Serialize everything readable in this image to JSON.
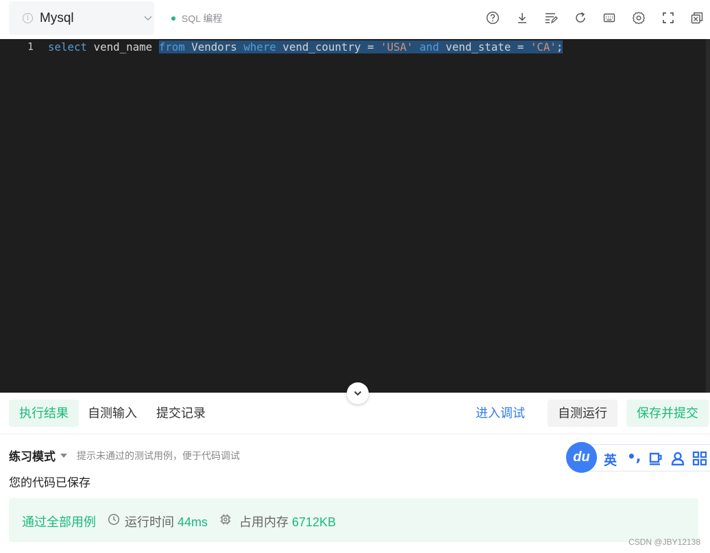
{
  "toolbar": {
    "language": "Mysql",
    "mode": "SQL 编程",
    "icons": [
      "help-icon",
      "download-icon",
      "format-icon",
      "refresh-icon",
      "keyboard-icon",
      "settings-icon",
      "fullscreen-icon",
      "exit-icon"
    ]
  },
  "editor": {
    "line_number": "1",
    "tokens": {
      "t1": "select",
      "t2": " vend_name ",
      "t3": "from",
      "t4": " Vendors ",
      "t5": "where",
      "t6": " vend_country = ",
      "t7": "'USA'",
      "t8": " ",
      "t9": "and",
      "t10": " vend_state = ",
      "t11": "'CA'",
      "t12": ";"
    }
  },
  "result_tabs": {
    "exec_result": "执行结果",
    "self_input": "自测输入",
    "submit_history": "提交记录"
  },
  "actions": {
    "debug": "进入调试",
    "self_run": "自测运行",
    "save_submit": "保存并提交"
  },
  "practice": {
    "title": "练习模式",
    "hint": "提示未通过的测试用例，便于代码调试",
    "saved": "您的代码已保存"
  },
  "status": {
    "pass": "通过全部用例",
    "time_label": "运行时间",
    "time_value": "44ms",
    "mem_label": "占用内存",
    "mem_value": "6712KB"
  },
  "ime": {
    "logo": "du",
    "lang": "英",
    "punc": "•,"
  },
  "watermark": "CSDN @JBY12138",
  "colors": {
    "accent_green": "#1ab97a",
    "accent_blue": "#2d7bf0",
    "editor_bg": "#1e1e1e",
    "selection": "#264f78"
  }
}
